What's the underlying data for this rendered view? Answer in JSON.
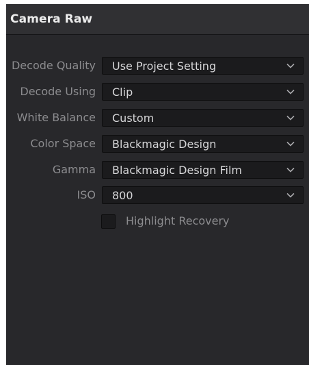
{
  "panel": {
    "title": "Camera Raw"
  },
  "settings": [
    {
      "label": "Decode Quality",
      "value": "Use Project Setting",
      "icon": "chevron-down-icon"
    },
    {
      "label": "Decode Using",
      "value": "Clip",
      "icon": "chevron-down-icon"
    },
    {
      "label": "White Balance",
      "value": "Custom",
      "icon": "chevron-down-icon"
    },
    {
      "label": "Color Space",
      "value": "Blackmagic Design",
      "icon": "chevron-down-icon"
    },
    {
      "label": "Gamma",
      "value": "Blackmagic Design Film",
      "icon": "chevron-down-icon"
    },
    {
      "label": "ISO",
      "value": "800",
      "icon": "chevron-down-icon"
    }
  ],
  "highlight_recovery": {
    "label": "Highlight Recovery",
    "checked": false
  },
  "colors": {
    "panel_bg": "#28282b",
    "header_bg": "#303033",
    "field_bg": "#1b1b1d",
    "label_text": "#8c8c8f",
    "value_text": "#d6d6d8",
    "title_text": "#ececec"
  }
}
